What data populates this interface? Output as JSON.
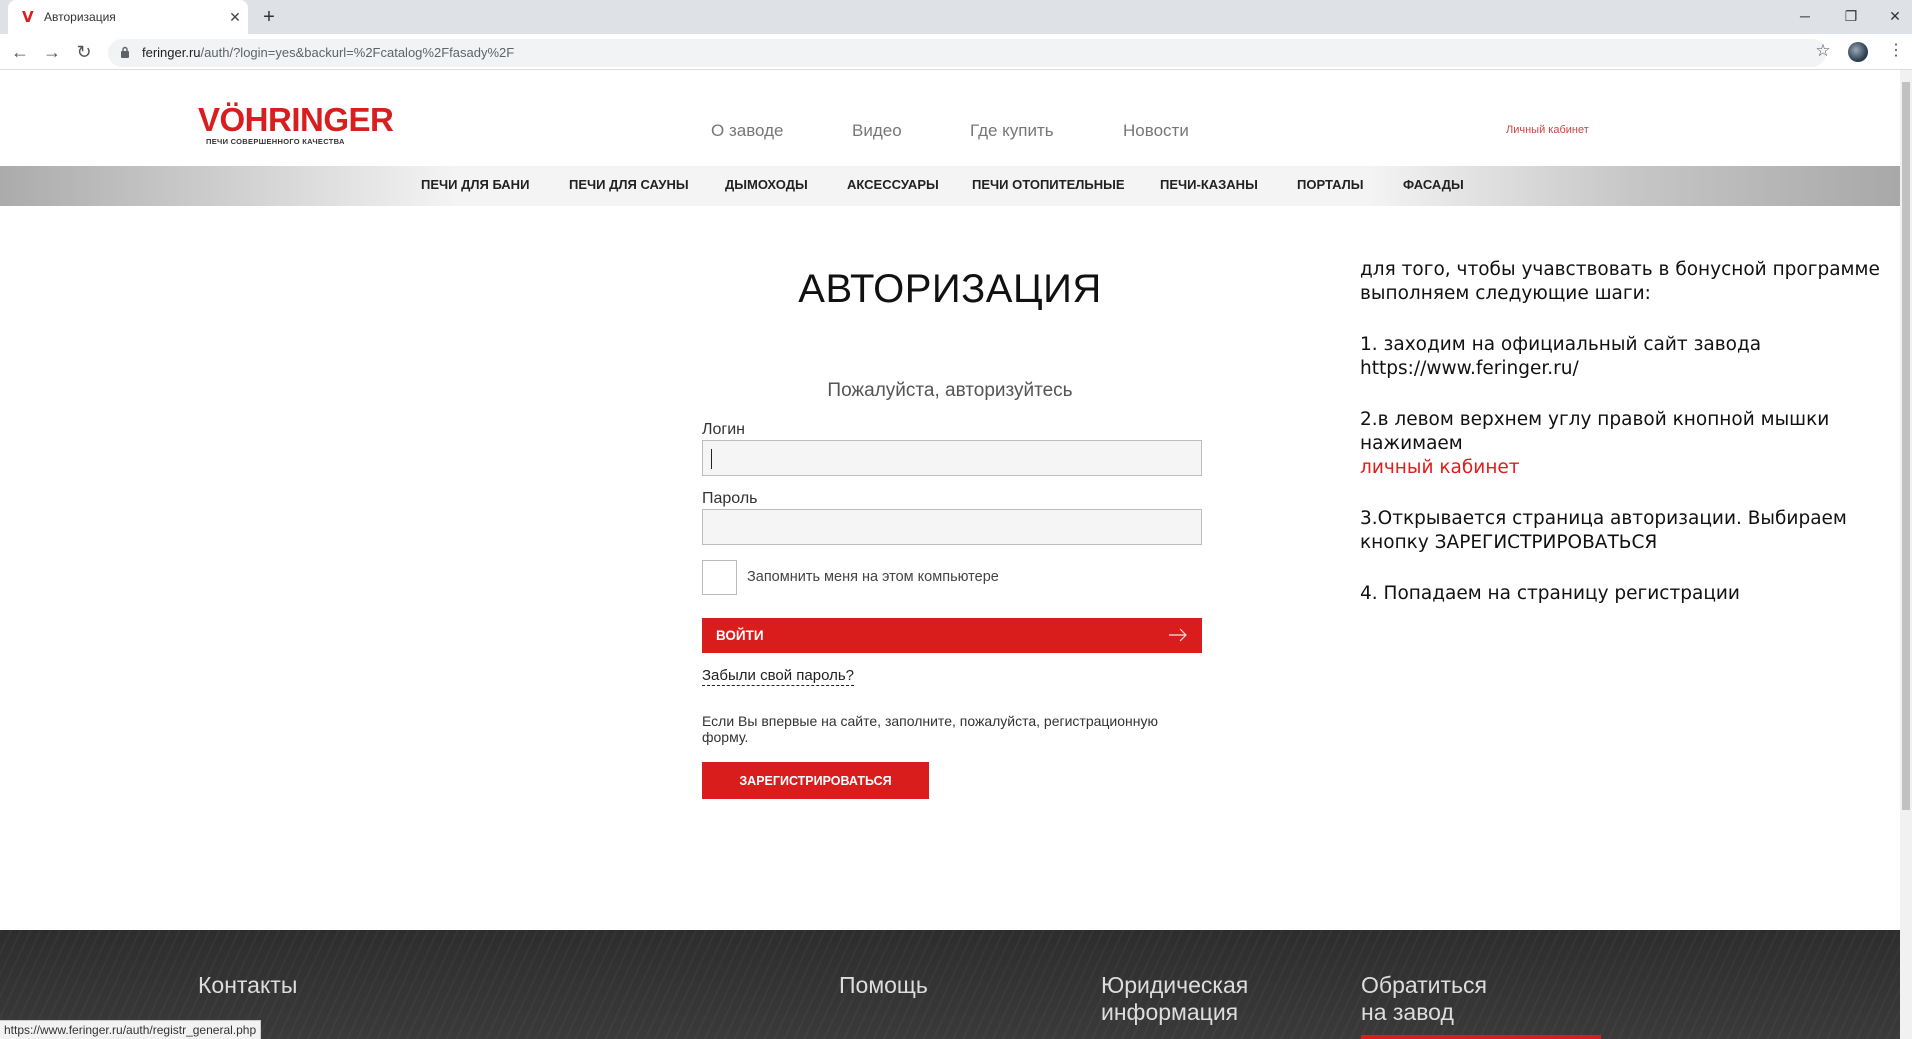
{
  "browser": {
    "tab_title": "Авторизация",
    "favicon_glyph": "V",
    "url_host": "feringer.ru",
    "url_path": "/auth/?login=yes&backurl=%2Fcatalog%2Ffasady%2F",
    "status_url": "https://www.feringer.ru/auth/registr_general.php"
  },
  "header": {
    "logo_text": "VÖHRINGER",
    "logo_tagline": "ПЕЧИ СОВЕРШЕННОГО КАЧЕСТВА",
    "nav": [
      "О заводе",
      "Видео",
      "Где купить",
      "Новости"
    ],
    "account_link": "Личный кабинет"
  },
  "categories": [
    "ПЕЧИ ДЛЯ БАНИ",
    "ПЕЧИ ДЛЯ САУНЫ",
    "ДЫМОХОДЫ",
    "АКСЕССУАРЫ",
    "ПЕЧИ ОТОПИТЕЛЬНЫЕ",
    "ПЕЧИ-КАЗАНЫ",
    "ПОРТАЛЫ",
    "ФАСАДЫ"
  ],
  "auth": {
    "title": "АВТОРИЗАЦИЯ",
    "subtitle": "Пожалуйста, авторизуйтесь",
    "login_label": "Логин",
    "login_value": "",
    "password_label": "Пароль",
    "password_value": "",
    "remember_label": "Запомнить меня на этом компьютере",
    "submit_label": "ВОЙТИ",
    "forgot_label": "Забыли свой пароль?",
    "register_hint": "Если Вы впервые на сайте, заполните, пожалуйста, регистрационную форму.",
    "register_label": "ЗАРЕГИСТРИРОВАТЬСЯ"
  },
  "instructions": {
    "intro": "для того, чтобы учавствовать в бонусной программе выполняем следующие шаги:",
    "step1": "1. заходим на официальный сайт завода https://www.feringer.ru/",
    "step2": "2.в левом верхнем углу правой кнопной мышки нажимаем",
    "step2_link": "личный кабинет",
    "step3": "3.Открывается страница авторизации. Выбираем кнопку ЗАРЕГИСТРИРОВАТЬСЯ",
    "step4": "4. Попадаем на страницу регистрации"
  },
  "footer": {
    "contacts": "Контакты",
    "help": "Помощь",
    "legal_line1": "Юридическая",
    "legal_line2": "информация",
    "contact_factory_line1": "Обратиться",
    "contact_factory_line2": "на завод"
  },
  "colors": {
    "brand_red": "#d91d1d",
    "link_red": "#e21b1b"
  }
}
